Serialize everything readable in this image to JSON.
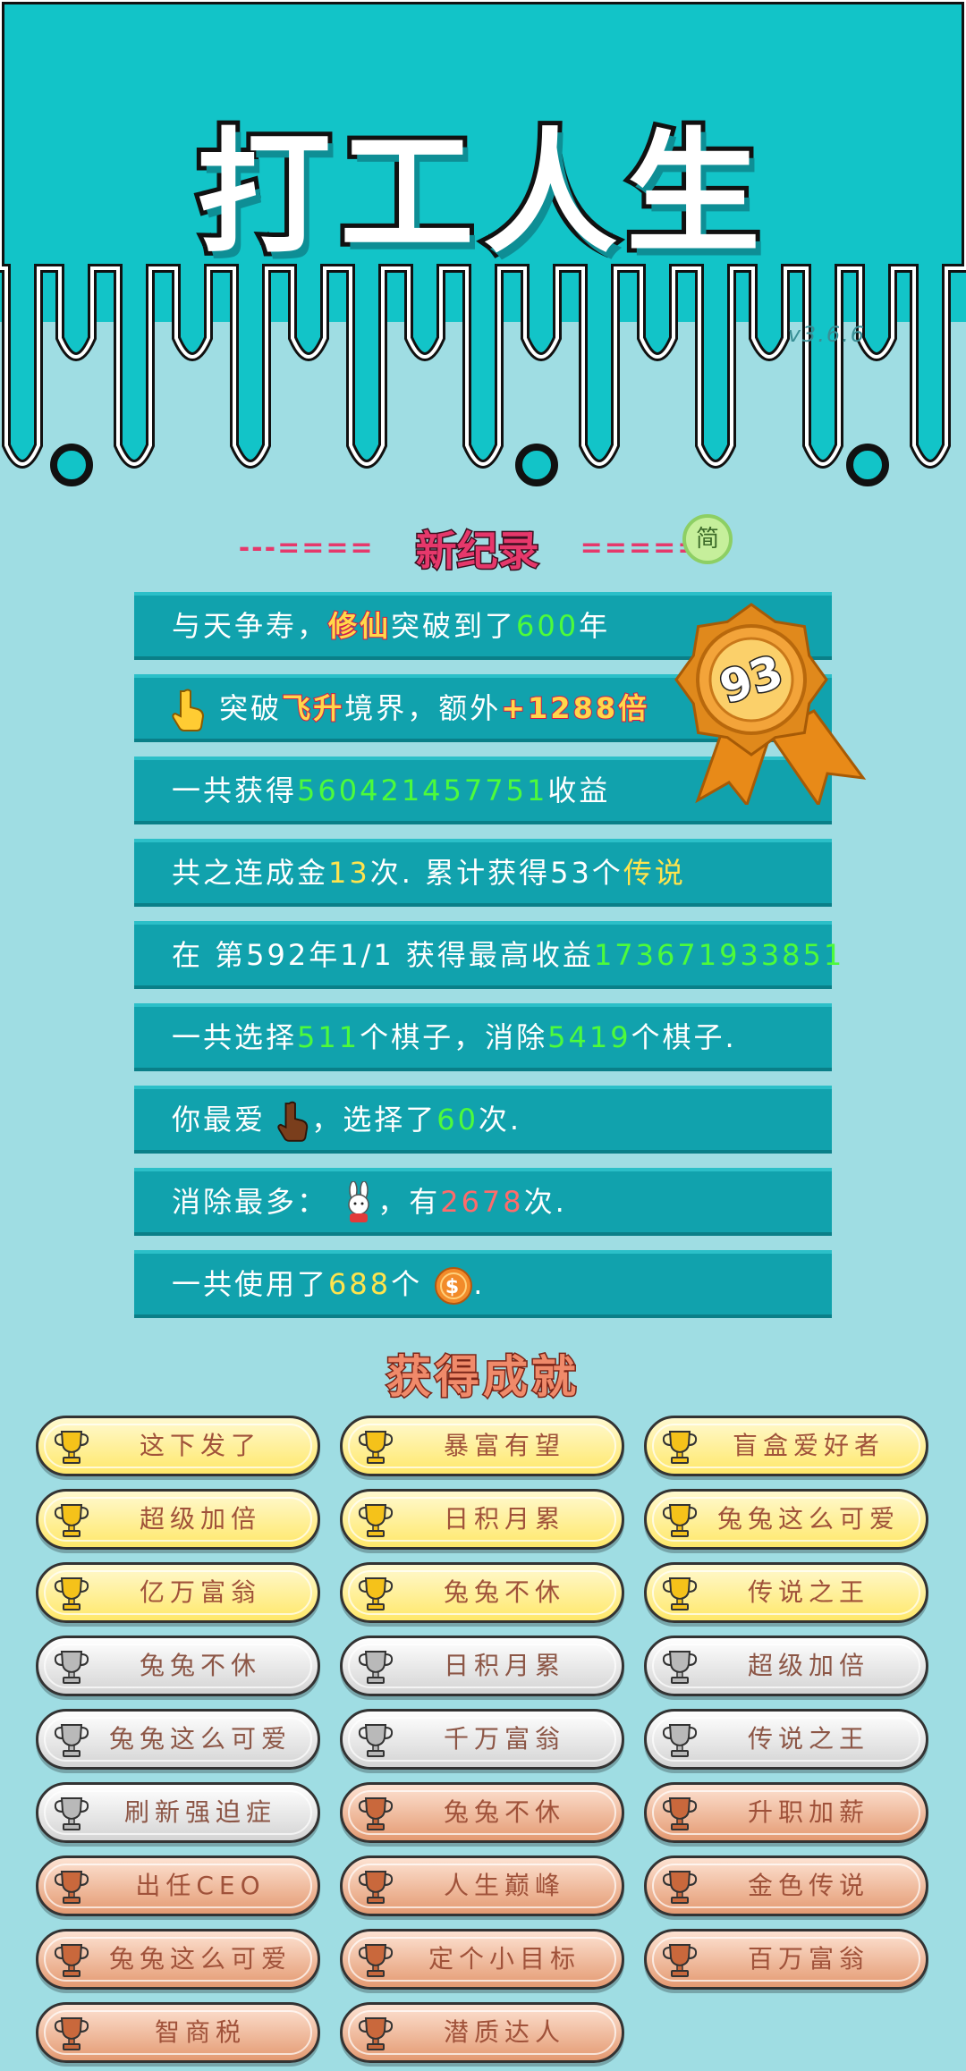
{
  "app": {
    "title": "打工人生",
    "version": "v3.6.6"
  },
  "record": {
    "dash_left": "---====",
    "heading": "新纪录",
    "dash_right": "=====--",
    "lang_badge": "简"
  },
  "medal": {
    "value": "93"
  },
  "stats": {
    "row1": {
      "pre": "与天争寿，",
      "hl": "修仙",
      "mid": "突破到了",
      "num": "600",
      "post": "年"
    },
    "row2": {
      "pre": "突破",
      "hl": "飞升",
      "mid": "境界，额外",
      "num": "+1288倍"
    },
    "row3": {
      "pre": "一共获得",
      "num": "560421457751",
      "post": "收益"
    },
    "row4": {
      "pre": "共之连成金",
      "num": "13",
      "mid": "次. 累计获得53个",
      "hl": "传说"
    },
    "row5": {
      "pre": "在 第592年1/1 获得最高收益",
      "num": "173671933851"
    },
    "row6": {
      "pre": "一共选择",
      "num1": "511",
      "mid": "个棋子，消除",
      "num2": "5419",
      "post": "个棋子."
    },
    "row7": {
      "pre": "你最爱",
      "mid": "，选择了",
      "num": "60",
      "post": "次."
    },
    "row8": {
      "pre": "消除最多：",
      "mid": "，有",
      "num": "2678",
      "post": "次."
    },
    "row9": {
      "pre": "一共使用了",
      "num": "688",
      "mid": "个",
      "post": "."
    }
  },
  "achievements": {
    "title": "获得成就",
    "items": [
      {
        "label": "这下发了",
        "tier": "gold"
      },
      {
        "label": "暴富有望",
        "tier": "gold"
      },
      {
        "label": "盲盒爱好者",
        "tier": "gold"
      },
      {
        "label": "超级加倍",
        "tier": "gold"
      },
      {
        "label": "日积月累",
        "tier": "gold"
      },
      {
        "label": "兔兔这么可爱",
        "tier": "gold"
      },
      {
        "label": "亿万富翁",
        "tier": "gold"
      },
      {
        "label": "兔兔不休",
        "tier": "gold"
      },
      {
        "label": "传说之王",
        "tier": "gold"
      },
      {
        "label": "兔兔不休",
        "tier": "silver"
      },
      {
        "label": "日积月累",
        "tier": "silver"
      },
      {
        "label": "超级加倍",
        "tier": "silver"
      },
      {
        "label": "兔兔这么可爱",
        "tier": "silver"
      },
      {
        "label": "千万富翁",
        "tier": "silver"
      },
      {
        "label": "传说之王",
        "tier": "silver"
      },
      {
        "label": "刷新强迫症",
        "tier": "silver"
      },
      {
        "label": "兔兔不休",
        "tier": "bronze"
      },
      {
        "label": "升职加薪",
        "tier": "bronze"
      },
      {
        "label": "出任CEO",
        "tier": "bronze"
      },
      {
        "label": "人生巅峰",
        "tier": "bronze"
      },
      {
        "label": "金色传说",
        "tier": "bronze"
      },
      {
        "label": "兔兔这么可爱",
        "tier": "bronze"
      },
      {
        "label": "定个小目标",
        "tier": "bronze"
      },
      {
        "label": "百万富翁",
        "tier": "bronze"
      },
      {
        "label": "智商税",
        "tier": "bronze"
      },
      {
        "label": "潜质达人",
        "tier": "bronze"
      }
    ]
  },
  "colors": {
    "header_bg": "#12c4c8",
    "page_bg": "#9fdde3",
    "row_bg": "#11a2ad",
    "green_value": "#4dfb3b",
    "yellow_value": "#ffe44d",
    "red_value": "#ff6b6b",
    "gold_trophy": "#f5c21a",
    "silver_trophy": "#b9b9b9",
    "bronze_trophy": "#c9683c"
  },
  "icons": {
    "row2": "pointing-hand-icon",
    "row7": "brown-pointing-hand-icon",
    "row8": "rabbit-icon",
    "row9": "coin-icon",
    "trophy": "trophy-icon"
  }
}
